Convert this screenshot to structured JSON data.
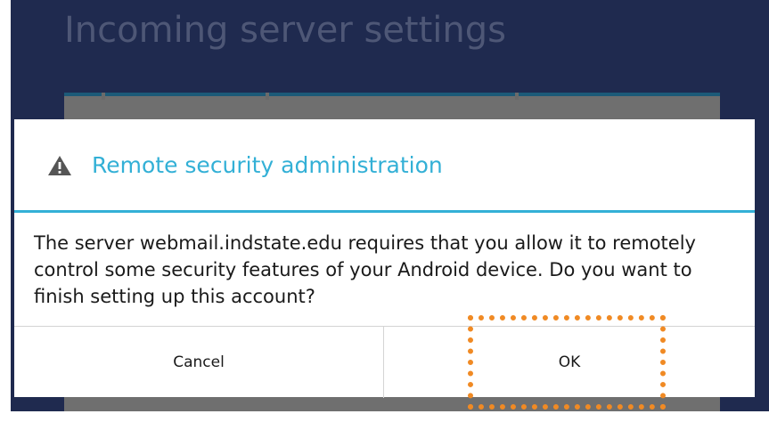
{
  "background": {
    "screen_title": "Incoming server settings"
  },
  "dialog": {
    "icon": "warning-triangle-icon",
    "title": "Remote security administration",
    "message": "The server webmail.indstate.edu requires that you allow it to remotely control some security features of your Android device. Do you want to finish setting up this account?",
    "cancel_label": "Cancel",
    "ok_label": "OK"
  },
  "colors": {
    "accent": "#33b0d6",
    "highlight": "#f08a24",
    "background": "#1f2a4f"
  }
}
